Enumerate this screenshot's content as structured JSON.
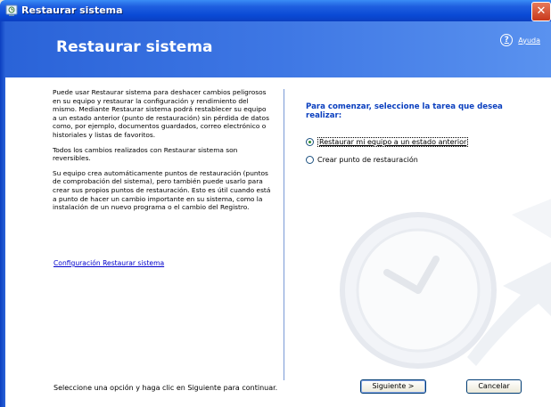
{
  "window": {
    "title": "Restaurar sistema",
    "close_label": "✕"
  },
  "header": {
    "title": "Restaurar sistema",
    "help_label": "Ayuda"
  },
  "left": {
    "paragraphs": [
      "Puede usar Restaurar sistema para deshacer cambios peligrosos en su equipo y restaurar la configuración y rendimiento del mismo. Mediante Restaurar sistema podrá restablecer su equipo a un estado anterior (punto de restauración) sin pérdida de datos como, por ejemplo, documentos guardados, correo electrónico o historiales y listas de favoritos.",
      "Todos los cambios realizados con Restaurar sistema son reversibles.",
      "Su equipo crea automáticamente puntos de restauración (puntos de comprobación del sistema), pero también puede usarlo para crear sus propios puntos de restauración. Esto es útil cuando está a punto de hacer un cambio importante en su sistema, como la instalación de un nuevo programa o el cambio del Registro."
    ],
    "config_link": "Configuración Restaurar sistema"
  },
  "right": {
    "heading": "Para comenzar, seleccione la tarea que desea realizar:",
    "options": [
      {
        "label": "Restaurar mi equipo a un estado anterior",
        "selected": true
      },
      {
        "label": "Crear punto de restauración",
        "selected": false
      }
    ]
  },
  "footer": {
    "instruction": "Seleccione una opción y haga clic en Siguiente para continuar.",
    "next_label": "Siguiente >",
    "cancel_label": "Cancelar"
  },
  "colors": {
    "header_blue": "#2a63d8",
    "heading_text": "#0a3fbf",
    "link": "#0000cc"
  }
}
